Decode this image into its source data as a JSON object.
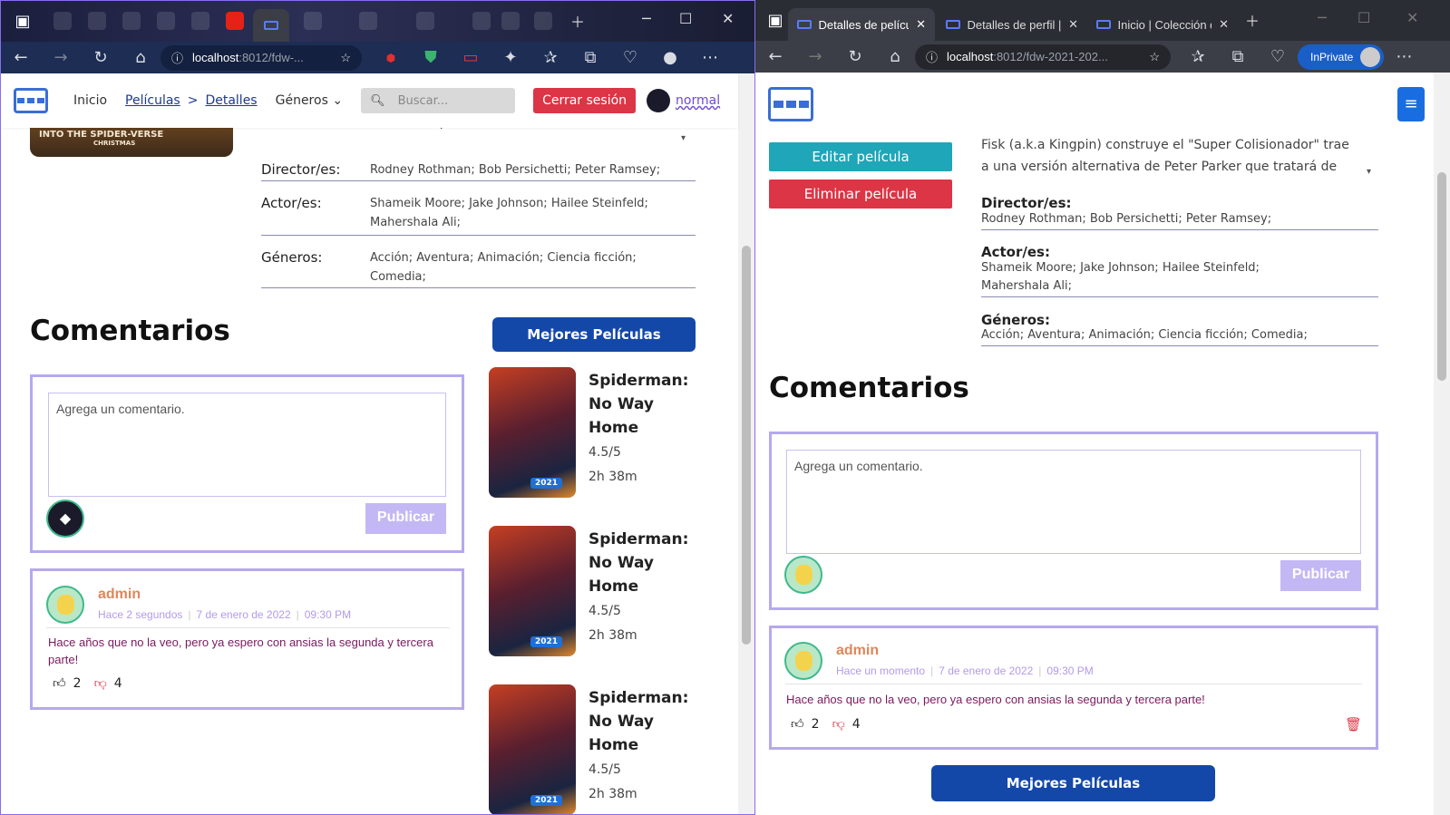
{
  "left": {
    "url_host": "localhost",
    "url_path": ":8012/fdw-...",
    "nav": {
      "home": "Inicio",
      "movies": "Películas",
      "sep": ">",
      "details": "Detalles",
      "genres": "Géneros",
      "search_placeholder": "Buscar...",
      "logout": "Cerrar sesión",
      "role": "normal"
    },
    "poster_caption": "INTO THE SPIDER-VERSE",
    "poster_sub": "CHRISTMAS",
    "synopsis_tail": "alternativa de Peter Parker que tratará de enseñarle a Miles",
    "director_label": "Director/es:",
    "directors": "Rodney Rothman;   Bob Persichetti;   Peter Ramsey;",
    "actor_label": "Actor/es:",
    "actors_1": "Shameik Moore;   Jake Johnson;   Hailee Steinfeld;",
    "actors_2": "Mahershala Ali;",
    "genre_label": "Géneros:",
    "genres_1": "Acción;   Aventura;   Animación;   Ciencia ficción;",
    "genres_2": "Comedia;",
    "comments_title": "Comentarios",
    "best_movies": "Mejores Películas",
    "comment_placeholder": "Agrega un comentario.",
    "publish": "Publicar",
    "comment": {
      "user": "admin",
      "time_ago": "Hace 2 segundos",
      "date": "7 de enero de 2022",
      "time": "09:30 PM",
      "text": "Hace años que no la veo, pero ya espero con ansias la segunda y tercera parte!",
      "likes": "2",
      "dislikes": "4"
    },
    "movies": [
      {
        "t1": "Spiderman:",
        "t2": "No Way",
        "t3": "Home",
        "rating": "4.5/5",
        "duration": "2h 38m",
        "year": "2021"
      },
      {
        "t1": "Spiderman:",
        "t2": "No Way",
        "t3": "Home",
        "rating": "4.5/5",
        "duration": "2h 38m",
        "year": "2021"
      },
      {
        "t1": "Spiderman:",
        "t2": "No Way",
        "t3": "Home",
        "rating": "4.5/5",
        "duration": "2h 38m",
        "year": "2021"
      }
    ]
  },
  "right": {
    "tabs": [
      "Detalles de película",
      "Detalles de perfil | C",
      "Inicio | Colección d"
    ],
    "url_host": "localhost",
    "url_path": ":8012/fdw-2021-202...",
    "inprivate": "InPrivate",
    "edit_movie": "Editar película",
    "delete_movie": "Eliminar película",
    "synopsis_1": "Fisk (a.k.a Kingpin) construye el \"Super Colisionador\" trae",
    "synopsis_2": "a una versión alternativa de Peter Parker que tratará de",
    "director_label": "Director/es:",
    "directors": "Rodney Rothman;   Bob Persichetti;   Peter Ramsey;",
    "actor_label": "Actor/es:",
    "actors_1": "Shameik Moore;   Jake Johnson;   Hailee Steinfeld;",
    "actors_2": "Mahershala Ali;",
    "genre_label": "Géneros:",
    "genres": "Acción;   Aventura;   Animación;   Ciencia ficción;   Comedia;",
    "comments_title": "Comentarios",
    "comment_placeholder": "Agrega un comentario.",
    "publish": "Publicar",
    "comment": {
      "user": "admin",
      "time_ago": "Hace un momento",
      "date": "7 de enero de 2022",
      "time": "09:30 PM",
      "text": "Hace años que no la veo, pero ya espero con ansias la segunda y tercera parte!",
      "likes": "2",
      "dislikes": "4"
    },
    "best_movies": "Mejores Películas"
  },
  "colors": {
    "accent_blue": "#1448a8",
    "danger": "#dc3545",
    "teal": "#1fa6b8",
    "lavender": "#b6a8ef",
    "username": "#e0865a"
  }
}
